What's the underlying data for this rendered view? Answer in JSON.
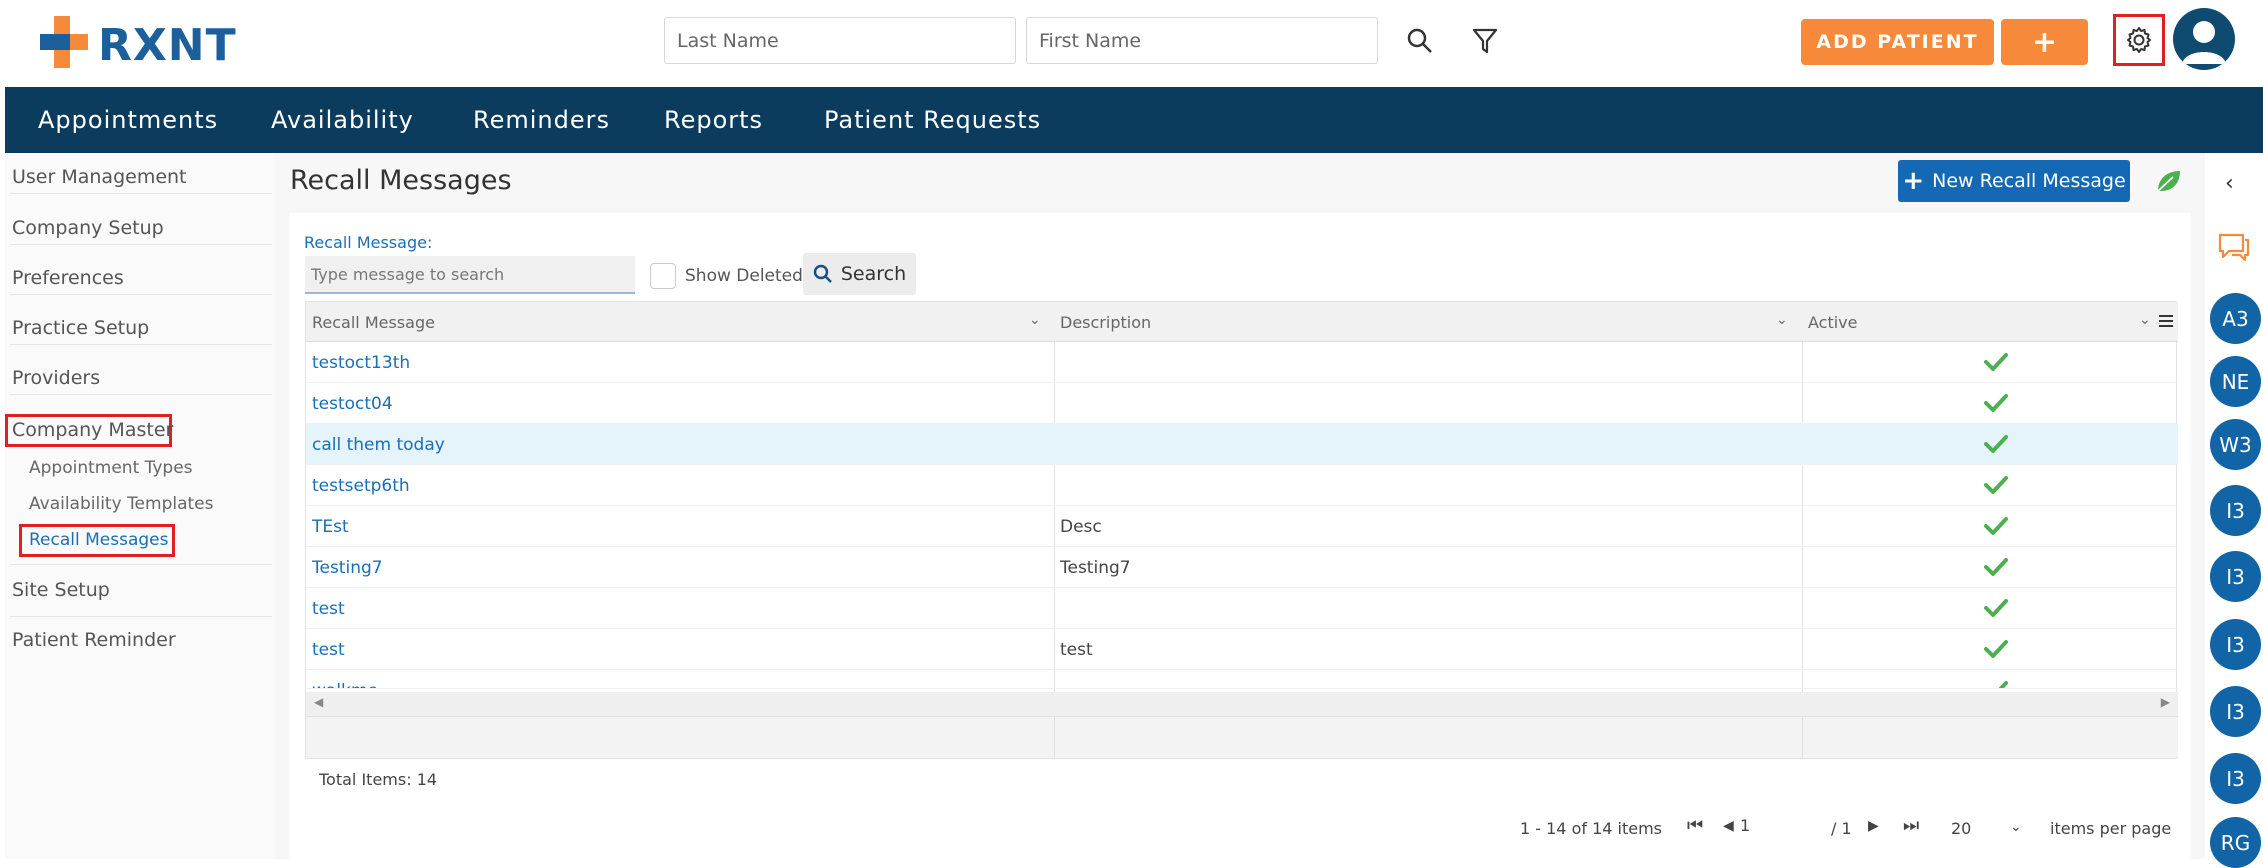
{
  "header": {
    "logo_text": "RXNT",
    "last_name_placeholder": "Last Name",
    "first_name_placeholder": "First Name",
    "add_patient_label": "ADD PATIENT",
    "plus_label": "+"
  },
  "nav": {
    "items": [
      "Appointments",
      "Availability",
      "Reminders",
      "Reports",
      "Patient Requests"
    ]
  },
  "sidebar": {
    "items": [
      "User Management",
      "Company Setup",
      "Preferences",
      "Practice Setup",
      "Providers",
      "Company Master",
      "Site Setup",
      "Patient Reminder"
    ],
    "sub_items": [
      "Appointment Types",
      "Availability Templates",
      "Recall Messages"
    ]
  },
  "main": {
    "title": "Recall Messages",
    "new_button_label": "New Recall Message",
    "filter_label": "Recall Message:",
    "filter_placeholder": "Type message to search",
    "show_deleted_label": "Show Deleted",
    "search_label": "Search"
  },
  "grid": {
    "columns": [
      "Recall Message",
      "Description",
      "Active"
    ],
    "rows": [
      {
        "message": "testoct13th",
        "description": "",
        "active": true
      },
      {
        "message": "testoct04",
        "description": "",
        "active": true
      },
      {
        "message": "call them today",
        "description": "",
        "active": true
      },
      {
        "message": "testsetp6th",
        "description": "",
        "active": true
      },
      {
        "message": "TEst",
        "description": "Desc",
        "active": true
      },
      {
        "message": "Testing7",
        "description": "Testing7",
        "active": true
      },
      {
        "message": "test",
        "description": "",
        "active": true
      },
      {
        "message": "test",
        "description": "test",
        "active": true
      },
      {
        "message": "walkme",
        "description": "",
        "active": true
      }
    ],
    "total_items": "Total Items: 14",
    "range": "1 - 14 of 14 items",
    "page_value": "1",
    "page_total": "/ 1",
    "per_page_value": "20",
    "per_page_label": "items per page"
  },
  "rail": {
    "badges": [
      "A3",
      "NE",
      "W3",
      "I3",
      "I3",
      "I3",
      "I3",
      "I3",
      "RG"
    ]
  },
  "colors": {
    "brand_blue": "#0b3c5d",
    "accent_orange": "#f7893b",
    "link_blue": "#1a6fb5",
    "check_green": "#4caf50",
    "highlight_red": "#e02020"
  }
}
